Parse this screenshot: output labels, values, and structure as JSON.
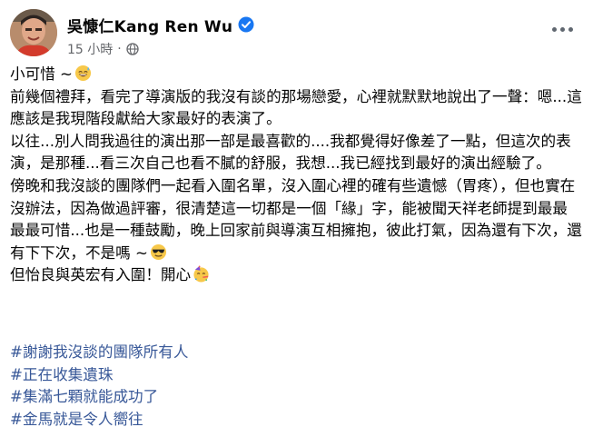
{
  "author": {
    "name": "吳慷仁Kang Ren Wu",
    "verified": true
  },
  "meta": {
    "time": "15 小時",
    "separator": "·",
    "privacy_icon": "globe-icon"
  },
  "post": {
    "lines": [
      "小可惜 ~",
      "前幾個禮拜，看完了導演版的我沒有談的那場戀愛，心裡就默默地說出了一聲：嗯...這應該是我現階段獻給大家最好的表演了。",
      "以往...別人問我過往的演出那一部是最喜歡的....我都覺得好像差了一點，但這次的表演，是那種...看三次自己也看不膩的舒服，我想...我已經找到最好的演出經驗了。",
      "傍晚和我沒談的團隊們一起看入圍名單，沒入圍心裡的確有些遺憾（胃疼），但也實在沒辦法，因為做過評審，很清楚這一切都是一個「緣」字，能被聞天祥老師提到最最最最可惜...也是一種鼓勵，晚上回家前與導演互相擁抱，彼此打氣，因為還有下次，還有下下次，不是嗎 ~",
      "但怡良與英宏有入圍！開心"
    ],
    "emojis": [
      "grinning-sweat-emoji",
      "sunglasses-emoji",
      "party-face-emoji"
    ]
  },
  "hashtags": [
    "#謝謝我沒談的團隊所有人",
    "#正在收集遺珠",
    "#集滿七顆就能成功了",
    "#金馬就是令人嚮往"
  ],
  "colors": {
    "link": "#385898",
    "meta": "#65676b",
    "verified": "#1877f2",
    "text": "#050505"
  }
}
